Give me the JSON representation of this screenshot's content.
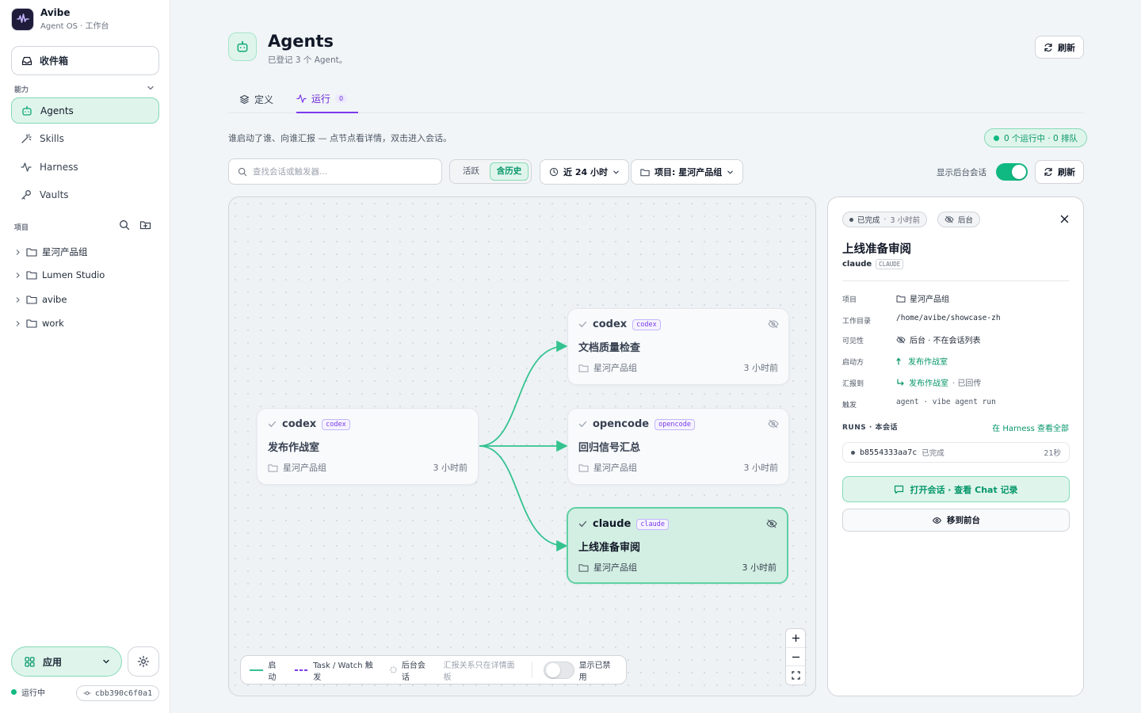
{
  "brand": {
    "name": "Avibe",
    "subtitle": "Agent OS · 工作台"
  },
  "sidebar": {
    "inbox_label": "收件箱",
    "capabilities_heading": "能力",
    "nav": [
      {
        "label": "Agents",
        "icon": "bot-icon",
        "active": true
      },
      {
        "label": "Skills",
        "icon": "wand-icon",
        "active": false
      },
      {
        "label": "Harness",
        "icon": "activity-icon",
        "active": false
      },
      {
        "label": "Vaults",
        "icon": "key-icon",
        "active": false
      }
    ],
    "projects_heading": "项目",
    "projects": [
      "星河产品组",
      "Lumen Studio",
      "avibe",
      "work"
    ],
    "apps_label": "应用",
    "status_text": "运行中",
    "commit": "cbb390c6f0a1"
  },
  "header": {
    "title": "Agents",
    "subtitle": "已登记 3 个 Agent。",
    "refresh_label": "刷新"
  },
  "tabs": [
    {
      "label": "定义",
      "active": false
    },
    {
      "label": "运行",
      "active": true,
      "badge": "0"
    }
  ],
  "toolbar": {
    "description": "谁启动了谁、向谁汇报 — 点节点看详情，双击进入会话。",
    "running_status": "0 个运行中 · 0 排队",
    "search_placeholder": "查找会话或触发器...",
    "segment": {
      "options": [
        "活跃",
        "含历史"
      ],
      "selected": "含历史"
    },
    "time_filter": "近 24 小时",
    "project_filter": "项目: 星河产品组",
    "show_background_label": "显示后台会话",
    "show_background_on": true,
    "refresh_label": "刷新"
  },
  "graph": {
    "nodes": [
      {
        "id": "n1",
        "engine": "codex",
        "badge": "codex",
        "title": "发布作战室",
        "project": "星河产品组",
        "ago": "3 小时前",
        "hidden_icon": false,
        "selected": false
      },
      {
        "id": "n2",
        "engine": "codex",
        "badge": "codex",
        "title": "文档质量检查",
        "project": "星河产品组",
        "ago": "3 小时前",
        "hidden_icon": true,
        "selected": false
      },
      {
        "id": "n3",
        "engine": "opencode",
        "badge": "opencode",
        "title": "回归信号汇总",
        "project": "星河产品组",
        "ago": "3 小时前",
        "hidden_icon": true,
        "selected": false
      },
      {
        "id": "n4",
        "engine": "claude",
        "badge": "claude",
        "title": "上线准备审阅",
        "project": "星河产品组",
        "ago": "3 小时前",
        "hidden_icon": true,
        "selected": true
      }
    ],
    "edges": [
      {
        "from": "n1",
        "to": "n2",
        "kind": "启动"
      },
      {
        "from": "n1",
        "to": "n3",
        "kind": "启动"
      },
      {
        "from": "n1",
        "to": "n4",
        "kind": "启动"
      }
    ],
    "legend": {
      "start": "启动",
      "trigger": "Task / Watch 触发",
      "background": "后台会话",
      "report_note": "汇报关系只在详情面板",
      "show_disabled": "显示已禁用",
      "show_disabled_on": false
    },
    "colors": {
      "start_edge": "#34c38f",
      "trigger_edge": "#7c3aed"
    }
  },
  "detail": {
    "status_chip": "已完成",
    "status_time": "3 小时前",
    "background_chip": "后台",
    "title": "上线准备审阅",
    "engine": "claude",
    "engine_tag": "CLAUDE",
    "fields": {
      "project": {
        "key": "项目",
        "value": "星河产品组"
      },
      "workdir": {
        "key": "工作目录",
        "value": "/home/avibe/showcase-zh"
      },
      "visibility": {
        "key": "可见性",
        "value": "后台 · 不在会话列表"
      },
      "starter": {
        "key": "启动方",
        "value": "发布作战室"
      },
      "report": {
        "key": "汇报到",
        "value": "发布作战室",
        "extra": "· 已回传"
      },
      "trigger": {
        "key": "触发",
        "value": "agent · vibe agent run"
      }
    },
    "runs_heading": "RUNS · 本会话",
    "runs_link": "在 Harness 查看全部",
    "runs": [
      {
        "id": "b8554333aa7c",
        "status": "已完成",
        "duration": "21秒"
      }
    ],
    "open_button": "打开会话 · 查看 Chat 记录",
    "foreground_button": "移到前台"
  }
}
